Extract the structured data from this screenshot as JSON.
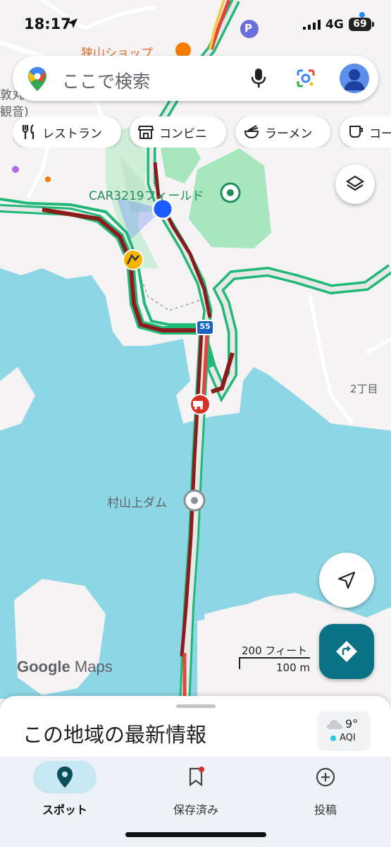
{
  "status_bar": {
    "time": "18:17",
    "network": "4G",
    "battery": "69"
  },
  "search": {
    "placeholder": "ここで検索"
  },
  "chips": [
    {
      "label": "レストラン",
      "icon": "fork-knife-icon"
    },
    {
      "label": "コンビニ",
      "icon": "store-icon"
    },
    {
      "label": "ラーメン",
      "icon": "ramen-icon"
    },
    {
      "label": "コー",
      "icon": "coffee-icon"
    }
  ],
  "map_labels": {
    "shop": "狭山ショップ",
    "field": "CAR3219フィールド",
    "dam": "村山上ダム",
    "district": "2丁目",
    "route": "55",
    "edge_top": "敦丸",
    "edge_bottom": "観音)"
  },
  "branding": {
    "logo_google": "Google",
    "logo_maps": "Maps"
  },
  "scale": {
    "feet": "200 フィート",
    "meters": "100 m"
  },
  "sheet": {
    "title": "この地域の最新情報"
  },
  "weather": {
    "temp": "9°",
    "aqi": "AQI"
  },
  "nav": [
    {
      "label": "スポット",
      "icon": "location-pin-icon",
      "active": true
    },
    {
      "label": "保存済み",
      "icon": "bookmark-icon",
      "active": false
    },
    {
      "label": "投稿",
      "icon": "add-circle-icon",
      "active": false
    }
  ],
  "colors": {
    "water": "#8dd6e6",
    "park": "#a8e6bf",
    "traffic_heavy": "#8b1c1c",
    "traffic_slow": "#e2463a",
    "traffic_clear": "#1fb876",
    "accent": "#0b7285",
    "location": "#1a5cff"
  }
}
